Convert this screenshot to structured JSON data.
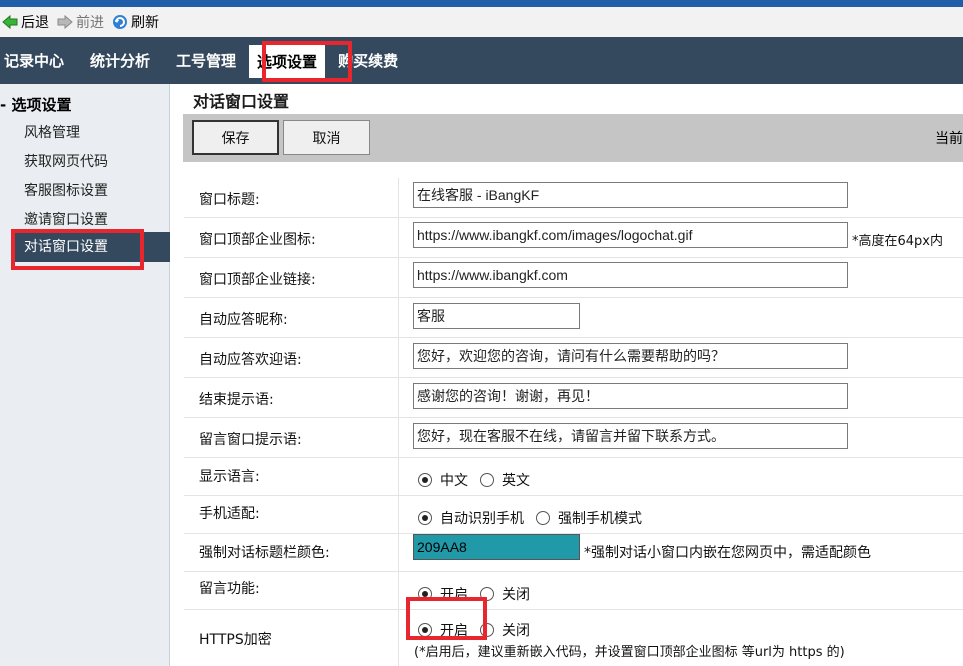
{
  "toolbar": {
    "back": "后退",
    "forward": "前进",
    "refresh": "刷新"
  },
  "nav": {
    "items": [
      "记录中心",
      "统计分析",
      "工号管理",
      "选项设置",
      "购买续费"
    ],
    "active_index": 3
  },
  "sidebar": {
    "heading": "选项设置",
    "items": [
      "风格管理",
      "获取网页代码",
      "客服图标设置",
      "邀请窗口设置",
      "对话窗口设置"
    ],
    "active_index": 4
  },
  "page": {
    "title": "对话窗口设置",
    "save": "保存",
    "cancel": "取消",
    "current": "当前"
  },
  "form": {
    "window_title": {
      "label": "窗口标题:",
      "value": "在线客服 - iBangKF"
    },
    "logo": {
      "label": "窗口顶部企业图标:",
      "value": "https://www.ibangkf.com/images/logochat.gif",
      "hint": "*高度在64px内"
    },
    "logo_link": {
      "label": "窗口顶部企业链接:",
      "value": "https://www.ibangkf.com"
    },
    "nickname": {
      "label": "自动应答昵称:",
      "value": "客服"
    },
    "welcome": {
      "label": "自动应答欢迎语:",
      "value": "您好，欢迎您的咨询，请问有什么需要帮助的吗？"
    },
    "ending": {
      "label": "结束提示语:",
      "value": "感谢您的咨询！谢谢，再见！"
    },
    "leave_msg_tip": {
      "label": "留言窗口提示语:",
      "value": "您好，现在客服不在线，请留言并留下联系方式。"
    },
    "language": {
      "label": "显示语言:",
      "options": [
        "中文",
        "英文"
      ],
      "selected": "中文"
    },
    "mobile": {
      "label": "手机适配:",
      "options": [
        "自动识别手机",
        "强制手机模式"
      ],
      "selected": "自动识别手机"
    },
    "title_color": {
      "label": "强制对话标题栏颜色:",
      "value": "209AA8",
      "hint": "*强制对话小窗口内嵌在您网页中，需适配颜色",
      "color": "#209aa8"
    },
    "leave_msg": {
      "label": "留言功能:",
      "options": [
        "开启",
        "关闭"
      ],
      "selected": "开启"
    },
    "https": {
      "label": "HTTPS加密",
      "options": [
        "开启",
        "关闭"
      ],
      "selected": "开启",
      "note": "(*启用后，建议重新嵌入代码，并设置窗口顶部企业图标 等url为 https 的)"
    }
  },
  "colors": {
    "nav_bg": "#35495e",
    "highlight": "#e8262d"
  }
}
